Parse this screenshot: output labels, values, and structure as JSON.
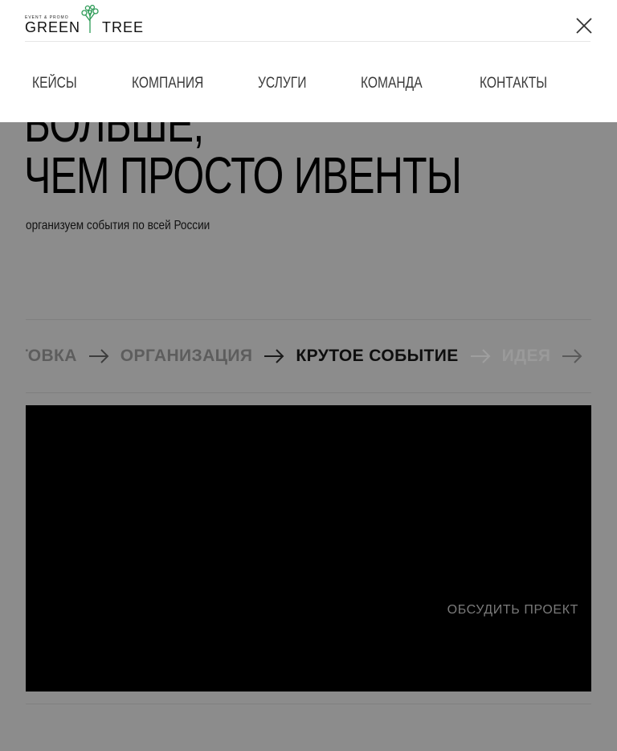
{
  "logo": {
    "tagline": "EVENT & PROMO",
    "word_left": "GREEN",
    "word_right": "TREE"
  },
  "nav": {
    "items": [
      {
        "label": "КЕЙСЫ"
      },
      {
        "label": "КОМПАНИЯ"
      },
      {
        "label": "УСЛУГИ"
      },
      {
        "label": "КОМАНДА"
      },
      {
        "label": "КОНТАКТЫ"
      }
    ],
    "close_icon": "close-icon"
  },
  "hero": {
    "title_line1": "БОЛЬШЕ,",
    "title_line2": "ЧЕМ ПРОСТО ИВЕНТЫ",
    "subtitle": "организуем события по всей России"
  },
  "process": {
    "steps": [
      "ТОВКА",
      "ОРГАНИЗАЦИЯ",
      "КРУТОЕ СОБЫТИЕ",
      "ИДЕЯ"
    ]
  },
  "video": {
    "cta_label": "ОБСУДИТЬ ПРОЕКТ"
  },
  "colors": {
    "accent_green": "#2e9b57",
    "overlay_gray": "#8c8c8c",
    "menu_bg": "#ffffff"
  }
}
